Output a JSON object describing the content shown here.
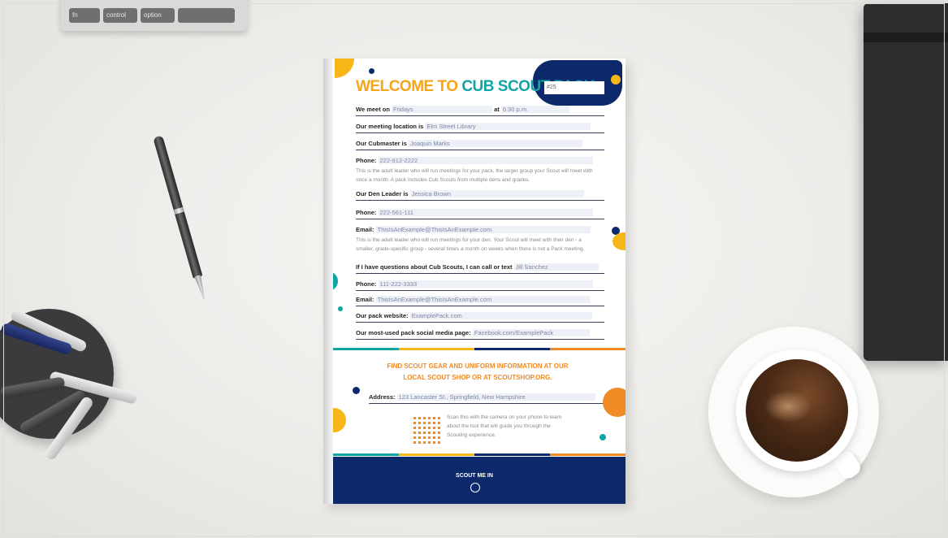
{
  "keyboard": {
    "keys": [
      "fn",
      "control",
      "option"
    ]
  },
  "flyer": {
    "title_part1": "WELCOME TO",
    "title_part2": "CUB SCOUT PACK",
    "pack_number": "#25",
    "rows": {
      "meet_label": "We meet on",
      "meet_value": "Fridays",
      "at_label": "at",
      "at_value": "6:30 p.m.",
      "location_label": "Our meeting location is",
      "location_value": "Elm Street Library",
      "cubmaster_label": "Our Cubmaster is",
      "cubmaster_value": "Joaquin Marks",
      "phone_label": "Phone:",
      "phone1_value": "222-912-2222",
      "note1": "This is the adult leader who will run meetings for your pack, the larger group your Scout will meet with once a month. A pack includes Cub Scouts from multiple dens and grades.",
      "den_label": "Our Den Leader is",
      "den_value": "Jessica Brown",
      "phone2_value": "222-561-111",
      "email_label": "Email:",
      "email1_value": "ThisIsAnExample@ThisIsAnExample.com",
      "note2": "This is the adult leader who will run meetings for your den. Your Scout will meet with their den - a smaller, grade-specific group - several times a month on weeks when there is not a Pack meeting.",
      "questions_label": "If I have questions about Cub Scouts, I can call or text",
      "questions_value": "Jill Sanchez",
      "phone3_value": "111-222-3333",
      "email2_value": "ThisIsAnExample@ThisIsAnExample.com",
      "website_label": "Our pack website:",
      "website_value": "ExamplePack.com",
      "social_label": "Our most-used pack social media page:",
      "social_value": "Facebook.com/ExamplePack"
    },
    "gear_heading_line1": "FIND SCOUT GEAR AND UNIFORM INFORMATION AT OUR",
    "gear_heading_line2": "LOCAL SCOUT SHOP OR AT SCOUTSHOP.ORG.",
    "address_label": "Address:",
    "address_value": "123 Lancaster St., Springfield, New Hampshire",
    "scan_text": "Scan this with the camera on your phone to learn about the tool that will guide you through the Scouting experience.",
    "footer_logo": "SCOUT ME IN"
  },
  "colors": {
    "navy": "#0c2a6b",
    "teal": "#12a3a3",
    "yellow": "#f8b718",
    "orange": "#f08a24"
  }
}
